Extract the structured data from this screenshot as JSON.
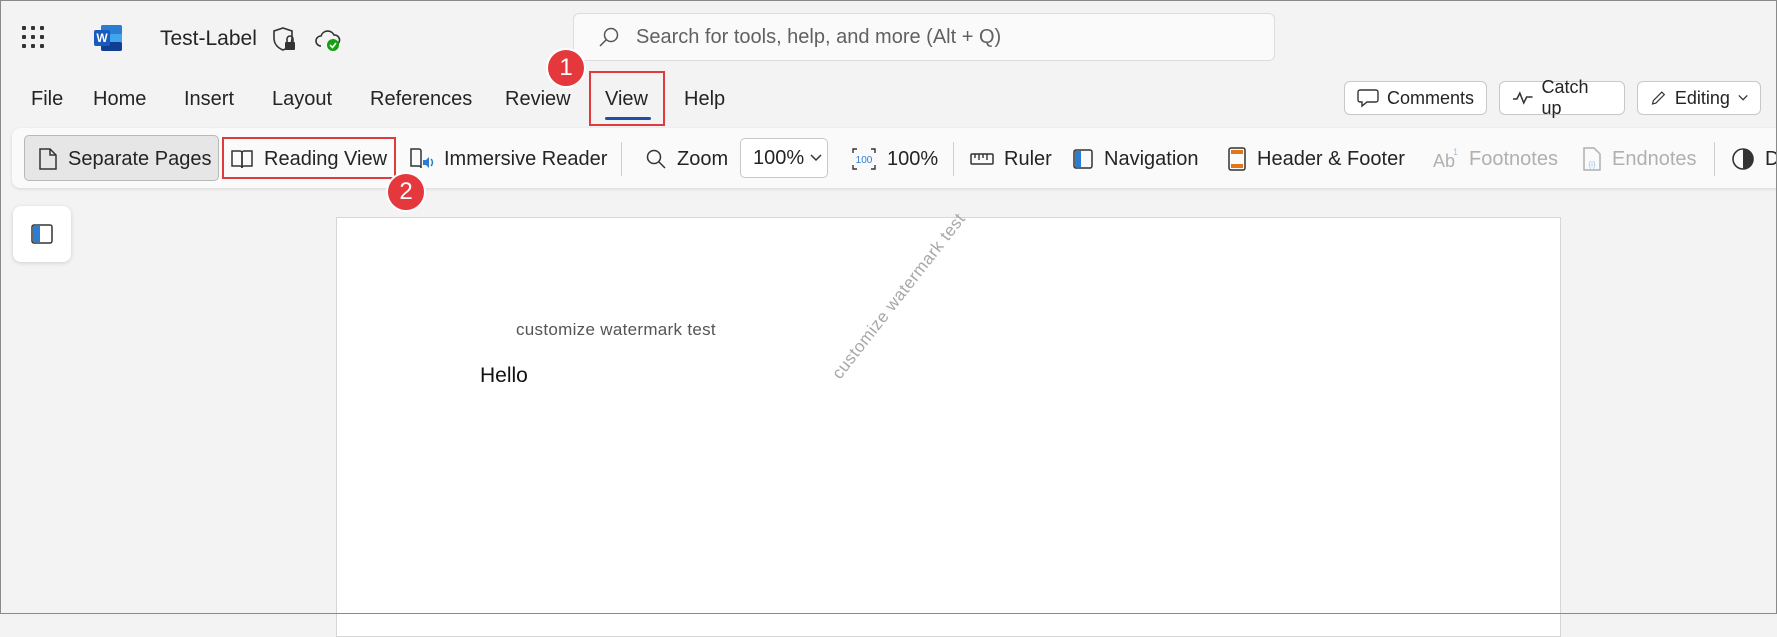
{
  "titlebar": {
    "doc_title": "Test-Label",
    "search_placeholder": "Search for tools, help, and more (Alt + Q)"
  },
  "menu": {
    "tabs": [
      "File",
      "Home",
      "Insert",
      "Layout",
      "References",
      "Review",
      "View",
      "Help"
    ],
    "active_tab": "View"
  },
  "top_buttons": {
    "comments": "Comments",
    "catch_up": "Catch up",
    "editing": "Editing"
  },
  "ribbon": {
    "separate_pages": "Separate Pages",
    "reading_view": "Reading View",
    "immersive_reader": "Immersive Reader",
    "zoom": "Zoom",
    "zoom_value": "100%",
    "zoom_100": "100%",
    "ruler": "Ruler",
    "navigation": "Navigation",
    "header_footer": "Header & Footer",
    "footnotes": "Footnotes",
    "endnotes": "Endnotes",
    "cut_off": "D"
  },
  "annotations": {
    "step1": "1",
    "step2": "2"
  },
  "document": {
    "header_watermark": "customize watermark test",
    "body_text": "Hello",
    "diagonal_watermark": "customize watermark test"
  },
  "colors": {
    "accent": "#1f4ea8",
    "highlight": "#e0393e",
    "word_blue": "#185abd"
  }
}
